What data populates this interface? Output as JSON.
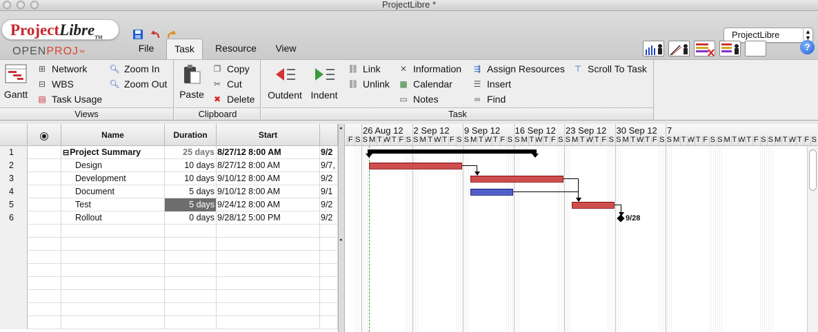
{
  "window": {
    "title": "ProjectLibre *"
  },
  "logo": {
    "brand_a": "Project",
    "brand_b": "Libre",
    "tm": "TM",
    "sub_a": "OPEN",
    "sub_b": "PROJ",
    "sub_tm": "™"
  },
  "menu": {
    "tabs": [
      "File",
      "Task",
      "Resource",
      "View"
    ],
    "active": "Task"
  },
  "app_selector": {
    "value": "ProjectLibre"
  },
  "help": {
    "label": "?"
  },
  "ribbon": {
    "views": {
      "gantt": "Gantt",
      "network": "Network",
      "wbs": "WBS",
      "task_usage": "Task Usage",
      "zoom_in": "Zoom In",
      "zoom_out": "Zoom Out",
      "label": "Views"
    },
    "clipboard": {
      "paste": "Paste",
      "copy": "Copy",
      "cut": "Cut",
      "delete": "Delete",
      "label": "Clipboard"
    },
    "task": {
      "outdent": "Outdent",
      "indent": "Indent",
      "link": "Link",
      "unlink": "Unlink",
      "information": "Information",
      "calendar": "Calendar",
      "notes": "Notes",
      "assign_resources": "Assign Resources",
      "insert": "Insert",
      "find": "Find",
      "scroll_to_task": "Scroll To Task",
      "label": "Task"
    }
  },
  "table": {
    "columns": [
      "",
      "Name",
      "Duration",
      "Start",
      ""
    ],
    "rows": [
      {
        "num": "1",
        "name": "Project Summary",
        "duration": "25 days",
        "start": "8/27/12 8:00 AM",
        "finish": "9/2",
        "summary": true
      },
      {
        "num": "2",
        "name": "Design",
        "duration": "10 days",
        "start": "8/27/12 8:00 AM",
        "finish": "9/7,"
      },
      {
        "num": "3",
        "name": "Development",
        "duration": "10 days",
        "start": "9/10/12 8:00 AM",
        "finish": "9/2"
      },
      {
        "num": "4",
        "name": "Document",
        "duration": "5 days",
        "start": "9/10/12 8:00 AM",
        "finish": "9/1"
      },
      {
        "num": "5",
        "name": "Test",
        "duration": "5 days",
        "start": "9/24/12 8:00 AM",
        "finish": "9/2",
        "selected_duration": true
      },
      {
        "num": "6",
        "name": "Rollout",
        "duration": "0 days",
        "start": "9/28/12 5:00 PM",
        "finish": "9/2"
      }
    ],
    "empty_rows": 8
  },
  "gantt": {
    "weeks": [
      "26 Aug 12",
      "2 Sep 12",
      "9 Sep 12",
      "16 Sep 12",
      "23 Sep 12",
      "30 Sep 12",
      "7"
    ],
    "days": [
      "F",
      "S",
      "S",
      "M",
      "T",
      "W",
      "T",
      "F",
      "S",
      "S",
      "M",
      "T",
      "W",
      "T",
      "F",
      "S",
      "S",
      "M",
      "T",
      "W",
      "T",
      "F",
      "S",
      "S",
      "M",
      "T",
      "W",
      "T",
      "F",
      "S",
      "S",
      "M",
      "T",
      "W",
      "T",
      "F",
      "S",
      "S",
      "M",
      "T",
      "W",
      "T",
      "F",
      "S",
      "S",
      "M",
      "T",
      "W",
      "T",
      "F",
      "S",
      "S",
      "M",
      "T",
      "W",
      "T",
      "F",
      "S",
      "S",
      "M",
      "T",
      "W",
      "T",
      "F",
      "S",
      "S"
    ],
    "milestone_label": "9/28",
    "colors": {
      "task_bar": "#c43d3d",
      "doc_bar": "#3a47b8",
      "summary": "#000000"
    }
  }
}
